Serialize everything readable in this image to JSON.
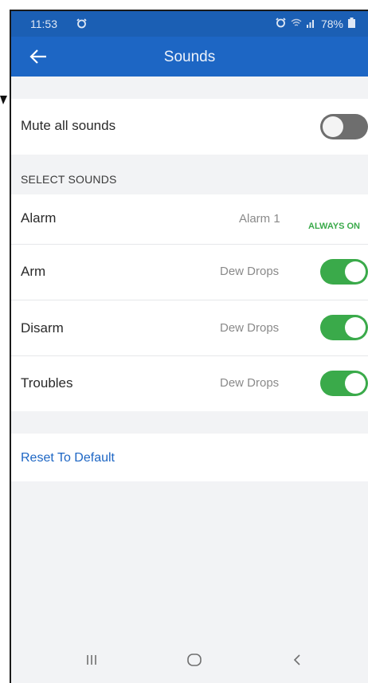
{
  "status_bar": {
    "time": "11:53",
    "battery": "78%"
  },
  "app_bar": {
    "title": "Sounds"
  },
  "mute": {
    "label": "Mute all sounds",
    "enabled": false
  },
  "select_sounds": {
    "header": "SELECT SOUNDS",
    "items": [
      {
        "label": "Alarm",
        "value": "Alarm 1",
        "status": "ALWAYS ON"
      },
      {
        "label": "Arm",
        "value": "Dew Drops",
        "enabled": true
      },
      {
        "label": "Disarm",
        "value": "Dew Drops",
        "enabled": true
      },
      {
        "label": "Troubles",
        "value": "Dew Drops",
        "enabled": true
      }
    ]
  },
  "reset": {
    "label": "Reset To Default"
  },
  "icons": {
    "status_alarm": "alarm-clock-icon",
    "wifi": "wifi-icon",
    "signal": "signal-icon",
    "battery": "battery-icon",
    "back": "back-arrow-icon",
    "nav_recents": "recents-icon",
    "nav_home": "home-icon",
    "nav_back": "nav-back-icon"
  },
  "colors": {
    "app_bar": "#1d66c4",
    "toggle_on": "#3aaa4a",
    "toggle_off": "#6e6e6e",
    "link": "#1d66c4"
  }
}
